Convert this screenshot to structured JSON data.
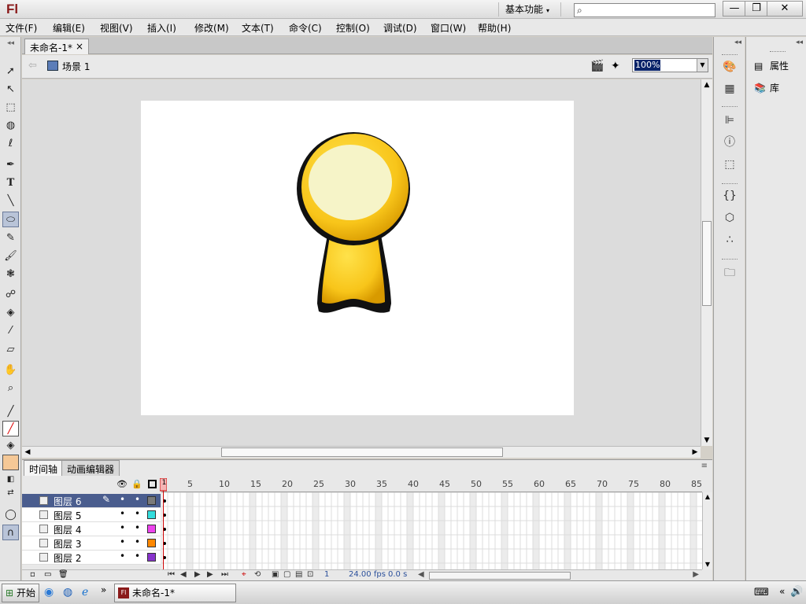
{
  "app": {
    "logo": "Fl",
    "workspace": "基本功能",
    "search_placeholder": ""
  },
  "window_controls": {
    "minimize": "—",
    "maximize": "❐",
    "close": "✕"
  },
  "menu": [
    "文件(F)",
    "编辑(E)",
    "视图(V)",
    "插入(I)",
    "修改(M)",
    "文本(T)",
    "命令(C)",
    "控制(O)",
    "调试(D)",
    "窗口(W)",
    "帮助(H)"
  ],
  "document": {
    "tab": "未命名-1*",
    "tab_close": "×",
    "scene": "场景 1",
    "zoom": "100%"
  },
  "timeline": {
    "tabs": [
      "时间轴",
      "动画编辑器"
    ],
    "ruler": [
      "5",
      "10",
      "15",
      "20",
      "25",
      "30",
      "35",
      "40",
      "45",
      "50",
      "55",
      "60",
      "65",
      "70",
      "75",
      "80",
      "85"
    ],
    "playhead": "1",
    "layers": [
      {
        "name": "图层 6",
        "color": "#7a7a7a",
        "selected": true
      },
      {
        "name": "图层 5",
        "color": "#33dddd",
        "selected": false
      },
      {
        "name": "图层 4",
        "color": "#ee44ee",
        "selected": false
      },
      {
        "name": "图层 3",
        "color": "#ff8800",
        "selected": false
      },
      {
        "name": "图层 2",
        "color": "#8833cc",
        "selected": false
      }
    ],
    "status": {
      "frame": "1",
      "fps": "24.00",
      "fps_unit": "fps",
      "time": "0.0",
      "time_unit": "s"
    }
  },
  "right_panel": {
    "properties": "属性",
    "library": "库"
  },
  "taskbar": {
    "start": "开始",
    "task": "未命名-1*"
  }
}
